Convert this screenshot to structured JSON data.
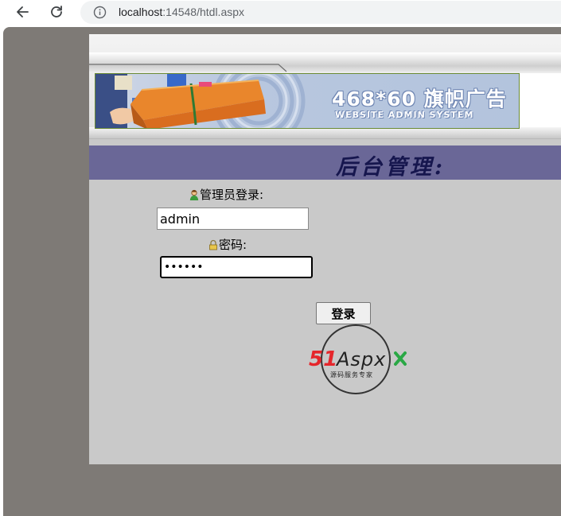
{
  "browser": {
    "url_host": "localhost",
    "url_rest": ":14548/htdl.aspx",
    "icons": {
      "back": "back-arrow-icon",
      "reload": "reload-icon",
      "info": "site-info-icon"
    }
  },
  "banner": {
    "title": "468*60 旗帜广告",
    "subtitle": "WEBSITE ADMIN SYSTEM"
  },
  "page": {
    "heading": "后台管理:"
  },
  "login": {
    "username_label": "管理员登录:",
    "username_value": "admin",
    "password_label": "密码:",
    "password_value": "••••••",
    "submit_label": "登录"
  },
  "logo": {
    "brand_num": "51",
    "brand_text": "Aspx",
    "tagline": "源码服务专家"
  },
  "colors": {
    "title_bar": "#6a6797",
    "page_background": "#c9c9c9",
    "outer_background": "#7e7a76",
    "logo_red": "#e5262b",
    "logo_green": "#2aa845"
  }
}
